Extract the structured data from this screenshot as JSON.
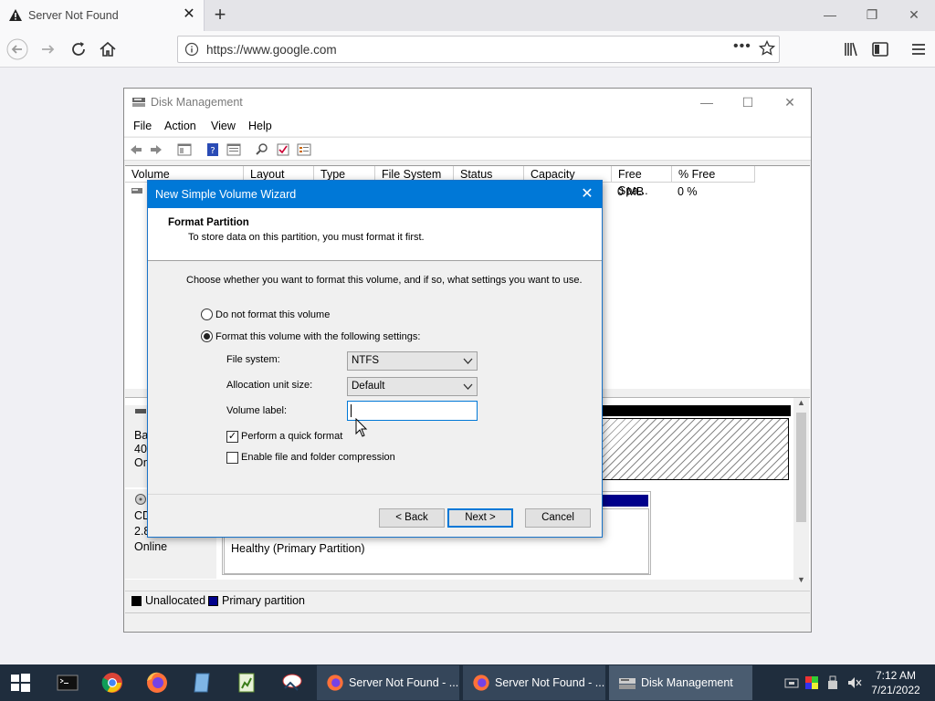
{
  "browser": {
    "tab_title": "Server Not Found",
    "url": "https://www.google.com"
  },
  "disk_management": {
    "title": "Disk Management",
    "menu": [
      "File",
      "Action",
      "View",
      "Help"
    ],
    "columns": [
      "Volume",
      "Layout",
      "Type",
      "File System",
      "Status",
      "Capacity",
      "Free Spa...",
      "% Free"
    ],
    "row": {
      "free_space": "0 MB",
      "pct_free": "0 %"
    },
    "disk0": {
      "line1": "Ba",
      "line2": "40.",
      "line3": "On"
    },
    "cdrom": {
      "line1": "CD",
      "line2": "2.8",
      "line3": "Online",
      "partition_status": "Healthy (Primary Partition)"
    },
    "legend": {
      "unallocated": "Unallocated",
      "primary": "Primary partition",
      "unallocated_color": "#000000",
      "primary_color": "#00008b"
    }
  },
  "wizard": {
    "title": "New Simple Volume Wizard",
    "heading": "Format Partition",
    "subheading": "To store data on this partition, you must format it first.",
    "instruction": "Choose whether you want to format this volume, and if so, what settings you want to use.",
    "option_no_format": "Do not format this volume",
    "option_format": "Format this volume with the following settings:",
    "file_system_label": "File system:",
    "file_system_value": "NTFS",
    "alloc_label": "Allocation unit size:",
    "alloc_value": "Default",
    "volume_label_label": "Volume label:",
    "volume_label_value": "",
    "quick_format": "Perform a quick format",
    "quick_format_checked": true,
    "compression": "Enable file and folder compression",
    "compression_checked": false,
    "back_button": "< Back",
    "next_button": "Next >",
    "cancel_button": "Cancel"
  },
  "taskbar": {
    "tasks": [
      {
        "label": "Server Not Found - ..."
      },
      {
        "label": "Server Not Found - ..."
      },
      {
        "label": "Disk Management"
      }
    ],
    "time": "7:12 AM",
    "date": "7/21/2022"
  }
}
